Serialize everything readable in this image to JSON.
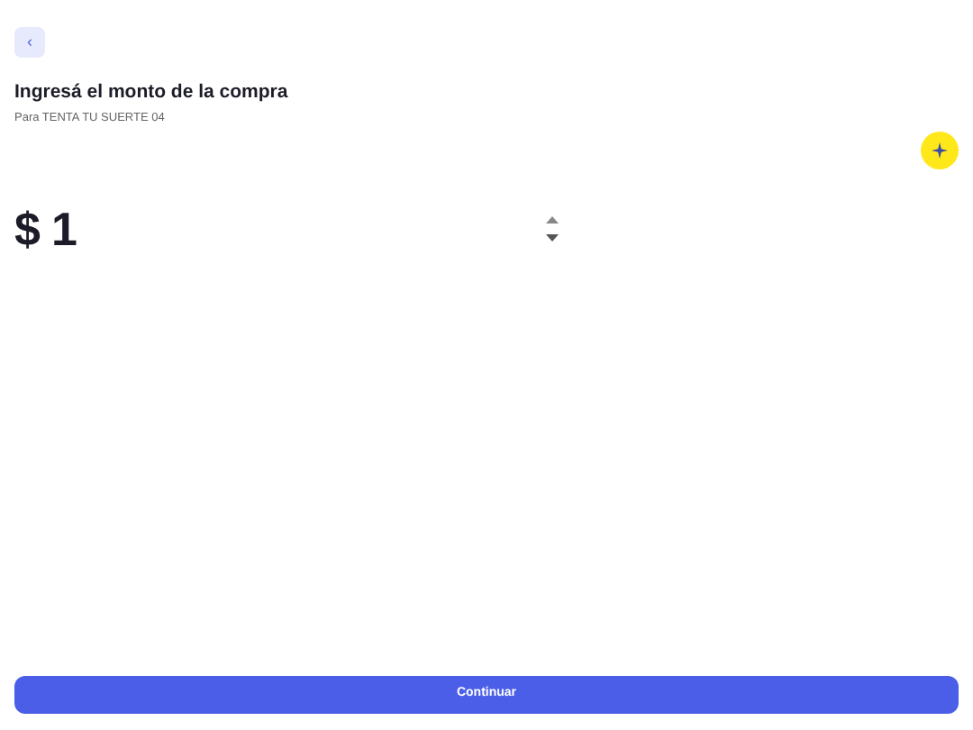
{
  "back_button": {
    "label": "‹"
  },
  "title": "Ingresá el monto de la compra",
  "subtitle": "Para TENTA TU SUERTE 04",
  "amount": {
    "currency": "$",
    "value": "1"
  },
  "continue_button": {
    "label": "Continuar"
  }
}
